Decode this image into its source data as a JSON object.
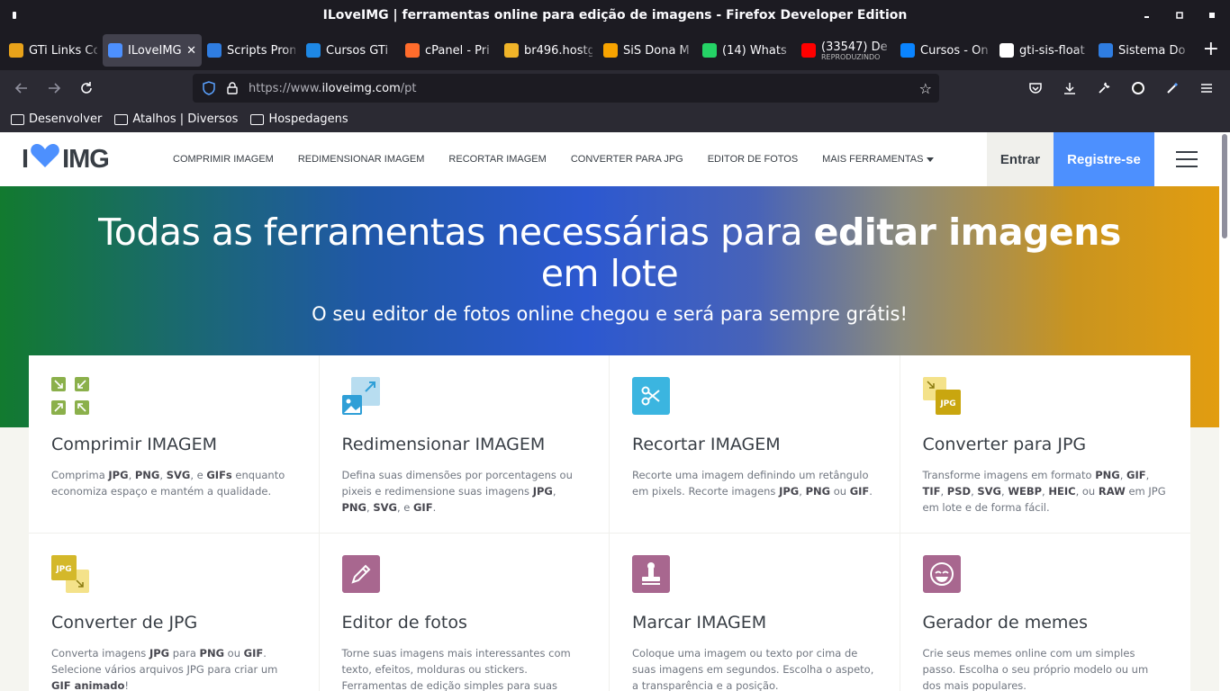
{
  "window": {
    "title": "ILoveIMG | ferramentas online para edição de imagens - Firefox Developer Edition"
  },
  "tabs": [
    {
      "label": "GTi Links Co",
      "color": "#e8a21a",
      "active": false
    },
    {
      "label": "ILoveIMG",
      "color": "#4d90fe",
      "active": true
    },
    {
      "label": "Scripts Pron",
      "color": "#2f7de1",
      "active": false
    },
    {
      "label": "Cursos GTi",
      "color": "#1e88e5",
      "active": false
    },
    {
      "label": "cPanel - Pri",
      "color": "#ff6c2c",
      "active": false
    },
    {
      "label": "br496.hostg",
      "color": "#f0b429",
      "active": false
    },
    {
      "label": "SiS Dona M",
      "color": "#f7a300",
      "active": false
    },
    {
      "label": "(14) Whats",
      "color": "#25d366",
      "active": false
    },
    {
      "label": "(33547) De",
      "sub": "REPRODUZINDO",
      "color": "#ff0000",
      "active": false
    },
    {
      "label": "Cursos - On",
      "color": "#0a84ff",
      "active": false
    },
    {
      "label": "gti-sis-float",
      "color": "#ffffff",
      "active": false
    },
    {
      "label": "Sistema Do",
      "color": "#2f7de1",
      "active": false
    }
  ],
  "navbar": {
    "url_prefix": "https://www.",
    "url_host": "iloveimg.com",
    "url_path": "/pt"
  },
  "bookmarks": [
    "Desenvolver",
    "Atalhos | Diversos",
    "Hospedagens"
  ],
  "site": {
    "logo_left": "I",
    "logo_right": "IMG",
    "menu": [
      "COMPRIMIR IMAGEM",
      "REDIMENSIONAR IMAGEM",
      "RECORTAR IMAGEM",
      "CONVERTER PARA JPG",
      "EDITOR DE FOTOS",
      "MAIS FERRAMENTAS"
    ],
    "login": "Entrar",
    "signup": "Registre-se"
  },
  "hero": {
    "title_part1": "Todas as ferramentas necessárias para ",
    "title_bold": "editar imagens",
    "title_line2": "em lote",
    "subtitle": "O seu editor de fotos online chegou e será para sempre grátis!"
  },
  "tools": [
    {
      "name": "compress",
      "title": "Comprimir IMAGEM",
      "desc": [
        [
          "Comprima ",
          0
        ],
        [
          "JPG",
          1
        ],
        [
          ", ",
          0
        ],
        [
          "PNG",
          1
        ],
        [
          ", ",
          0
        ],
        [
          "SVG",
          1
        ],
        [
          ", e ",
          0
        ],
        [
          "GIFs",
          1
        ],
        [
          " enquanto economiza espaço e mantém a qualidade.",
          0
        ]
      ],
      "color": "#8bb04b"
    },
    {
      "name": "resize",
      "title": "Redimensionar IMAGEM",
      "desc": [
        [
          "Defina suas dimensões por porcentagens ou pixeis e redimensione suas imagens ",
          0
        ],
        [
          "JPG",
          1
        ],
        [
          ", ",
          0
        ],
        [
          "PNG",
          1
        ],
        [
          ", ",
          0
        ],
        [
          "SVG",
          1
        ],
        [
          ", e ",
          0
        ],
        [
          "GIF",
          1
        ],
        [
          ".",
          0
        ]
      ],
      "color": "#2f9fd7"
    },
    {
      "name": "crop",
      "title": "Recortar IMAGEM",
      "desc": [
        [
          "Recorte uma imagem definindo um retângulo em pixels. Recorte imagens ",
          0
        ],
        [
          "JPG",
          1
        ],
        [
          ", ",
          0
        ],
        [
          "PNG",
          1
        ],
        [
          " ou ",
          0
        ],
        [
          "GIF",
          1
        ],
        [
          ".",
          0
        ]
      ],
      "color": "#3bb5e0"
    },
    {
      "name": "convert-to-jpg",
      "title": "Converter para JPG",
      "desc": [
        [
          "Transforme imagens em formato ",
          0
        ],
        [
          "PNG",
          1
        ],
        [
          ", ",
          0
        ],
        [
          "GIF",
          1
        ],
        [
          ", ",
          0
        ],
        [
          "TIF",
          1
        ],
        [
          ", ",
          0
        ],
        [
          "PSD",
          1
        ],
        [
          ", ",
          0
        ],
        [
          "SVG",
          1
        ],
        [
          ", ",
          0
        ],
        [
          "WEBP",
          1
        ],
        [
          ", ",
          0
        ],
        [
          "HEIC",
          1
        ],
        [
          ", ou ",
          0
        ],
        [
          "RAW",
          1
        ],
        [
          " em JPG em lote e de forma fácil.",
          0
        ]
      ],
      "color": "#c9a60f"
    },
    {
      "name": "convert-from-jpg",
      "title": "Converter de JPG",
      "desc": [
        [
          "Converta imagens ",
          0
        ],
        [
          "JPG",
          1
        ],
        [
          " para ",
          0
        ],
        [
          "PNG",
          1
        ],
        [
          " ou ",
          0
        ],
        [
          "GIF",
          1
        ],
        [
          ". Selecione vários arquivos JPG para criar um ",
          0
        ],
        [
          "GIF animado",
          1
        ],
        [
          "!",
          0
        ]
      ],
      "color": "#d4b82a"
    },
    {
      "name": "photo-editor",
      "title": "Editor de fotos",
      "desc": [
        [
          "Torne suas imagens mais interessantes com texto, efeitos, molduras ou stickers. Ferramentas de edição simples para suas",
          0
        ]
      ],
      "color": "#a8678f"
    },
    {
      "name": "watermark",
      "title": "Marcar IMAGEM",
      "desc": [
        [
          "Coloque uma imagem ou texto por cima de suas imagens em segundos. Escolha o aspeto, a transparência e a posição.",
          0
        ]
      ],
      "color": "#a8678f"
    },
    {
      "name": "meme",
      "title": "Gerador de memes",
      "desc": [
        [
          "Crie seus memes online com um simples passo. Escolha o seu próprio modelo ou um dos mais populares.",
          0
        ]
      ],
      "color": "#a8678f"
    }
  ]
}
